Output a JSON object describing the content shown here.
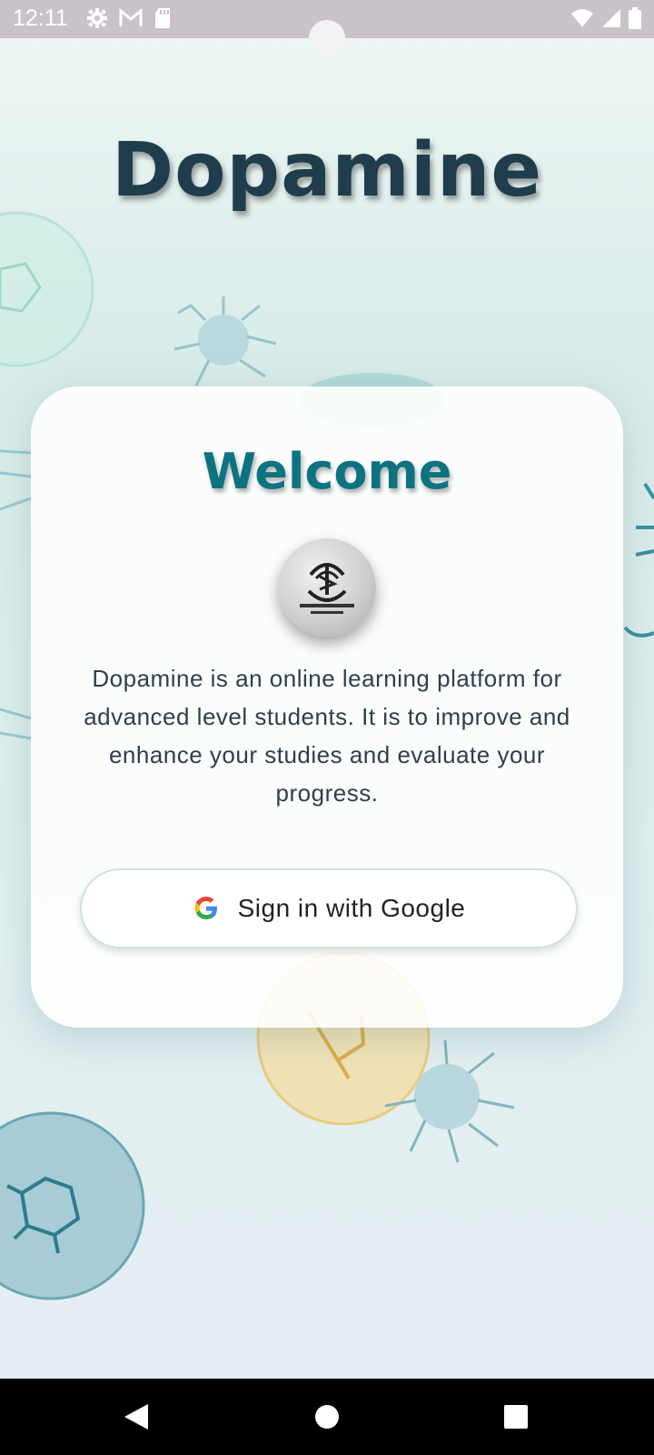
{
  "status_bar": {
    "time": "12:11",
    "left_icons": [
      "gear-icon",
      "gmail-icon",
      "sd-card-icon"
    ],
    "right_icons": [
      "wifi-icon",
      "signal-icon",
      "battery-icon"
    ]
  },
  "app": {
    "title": "Dopamine"
  },
  "card": {
    "heading": "Welcome",
    "logo_icon": "app-logo",
    "description": "Dopamine is an online learning platform for advanced level students. It is to improve and enhance your studies and evaluate your progress.",
    "sign_in_button": {
      "label": "Sign in with Google",
      "icon": "google-icon"
    }
  },
  "nav_bar": {
    "buttons": [
      "back-icon",
      "home-icon",
      "recents-icon"
    ]
  },
  "colors": {
    "title": "#1f3d4c",
    "heading": "#0d7380",
    "status_bar": "#c9c3c9",
    "nav_bar": "#000000"
  }
}
